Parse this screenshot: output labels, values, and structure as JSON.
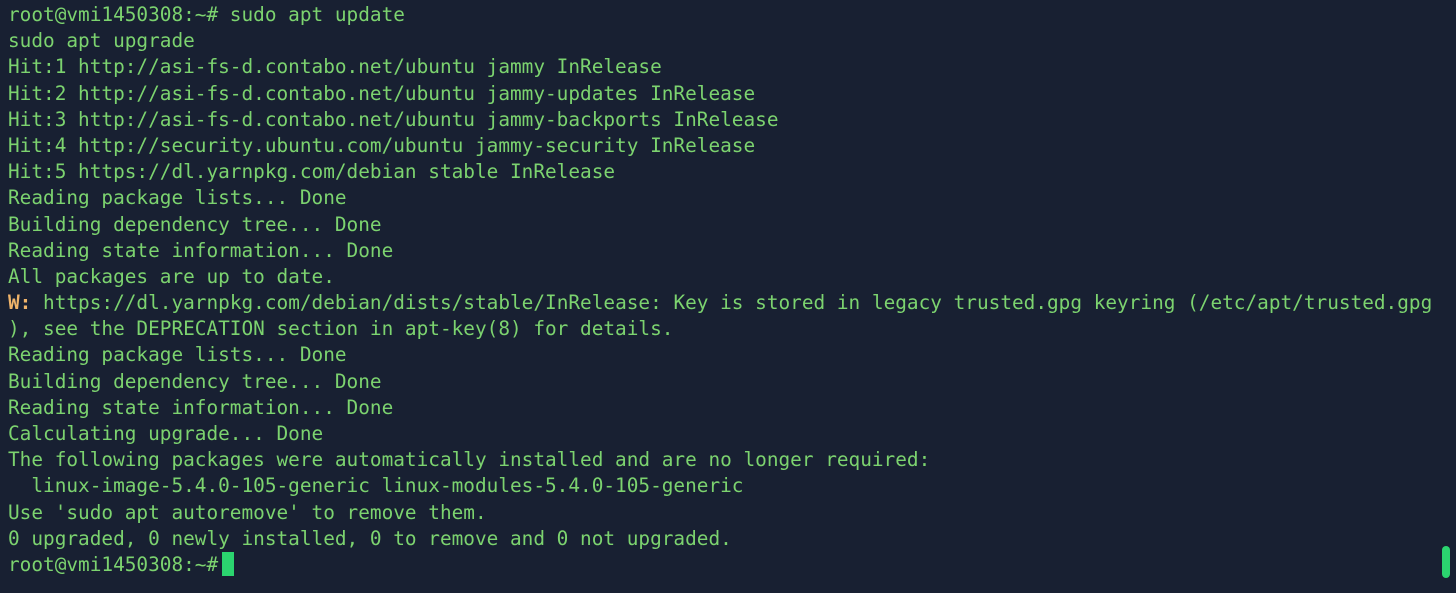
{
  "terminal": {
    "prompt": "root@vmi1450308:~#",
    "colors": {
      "background": "#182032",
      "text": "#7cd36f",
      "warning": "#f0b46a",
      "cursor": "#2bd46f"
    },
    "lines": [
      "root@vmi1450308:~# sudo apt update",
      "sudo apt upgrade",
      "Hit:1 http://asi-fs-d.contabo.net/ubuntu jammy InRelease",
      "Hit:2 http://asi-fs-d.contabo.net/ubuntu jammy-updates InRelease",
      "Hit:3 http://asi-fs-d.contabo.net/ubuntu jammy-backports InRelease",
      "Hit:4 http://security.ubuntu.com/ubuntu jammy-security InRelease",
      "Hit:5 https://dl.yarnpkg.com/debian stable InRelease",
      "Reading package lists... Done",
      "Building dependency tree... Done",
      "Reading state information... Done",
      "All packages are up to date."
    ],
    "warning": {
      "prefix": "W:",
      "text": " https://dl.yarnpkg.com/debian/dists/stable/InRelease: Key is stored in legacy trusted.gpg keyring (/etc/apt/trusted.gpg",
      "continuation": "), see the DEPRECATION section in apt-key(8) for details."
    },
    "lines_after": [
      "Reading package lists... Done",
      "Building dependency tree... Done",
      "Reading state information... Done",
      "Calculating upgrade... Done",
      "The following packages were automatically installed and are no longer required:",
      "  linux-image-5.4.0-105-generic linux-modules-5.4.0-105-generic",
      "Use 'sudo apt autoremove' to remove them.",
      "0 upgraded, 0 newly installed, 0 to remove and 0 not upgraded."
    ],
    "final_prompt": "root@vmi1450308:~#"
  }
}
